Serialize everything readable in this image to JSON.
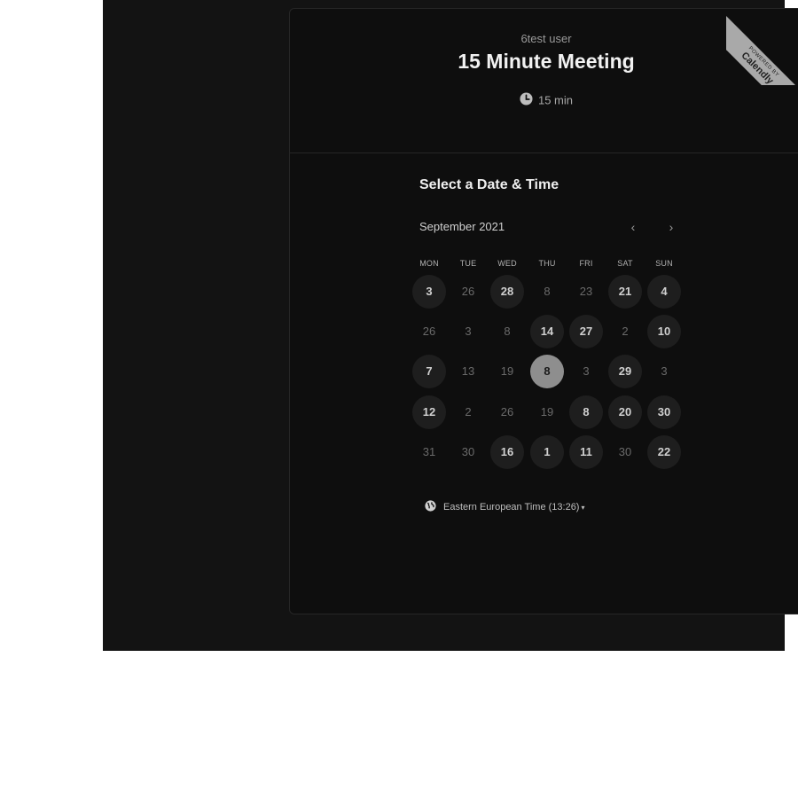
{
  "event": {
    "owner": "6test user",
    "title": "15 Minute Meeting",
    "duration": "15 min"
  },
  "ribbon": {
    "small": "POWERED BY",
    "brand": "Calendly"
  },
  "calendar": {
    "section_title": "Select a Date & Time",
    "month_label": "September 2021",
    "prev_icon": "‹",
    "next_icon": "›",
    "weekdays": [
      "MON",
      "TUE",
      "WED",
      "THU",
      "FRI",
      "SAT",
      "SUN"
    ],
    "rows": [
      [
        {
          "label": "3",
          "state": "available"
        },
        {
          "label": "26",
          "state": "unavailable"
        },
        {
          "label": "28",
          "state": "available"
        },
        {
          "label": "8",
          "state": "unavailable"
        },
        {
          "label": "23",
          "state": "unavailable"
        },
        {
          "label": "21",
          "state": "available"
        },
        {
          "label": "4",
          "state": "available"
        }
      ],
      [
        {
          "label": "26",
          "state": "unavailable"
        },
        {
          "label": "3",
          "state": "unavailable"
        },
        {
          "label": "8",
          "state": "unavailable"
        },
        {
          "label": "14",
          "state": "available"
        },
        {
          "label": "27",
          "state": "available"
        },
        {
          "label": "2",
          "state": "unavailable"
        },
        {
          "label": "10",
          "state": "available"
        }
      ],
      [
        {
          "label": "7",
          "state": "available"
        },
        {
          "label": "13",
          "state": "unavailable"
        },
        {
          "label": "19",
          "state": "unavailable"
        },
        {
          "label": "8",
          "state": "selected"
        },
        {
          "label": "3",
          "state": "unavailable"
        },
        {
          "label": "29",
          "state": "available"
        },
        {
          "label": "3",
          "state": "unavailable"
        }
      ],
      [
        {
          "label": "12",
          "state": "available"
        },
        {
          "label": "2",
          "state": "unavailable"
        },
        {
          "label": "26",
          "state": "unavailable"
        },
        {
          "label": "19",
          "state": "unavailable"
        },
        {
          "label": "8",
          "state": "available"
        },
        {
          "label": "20",
          "state": "available"
        },
        {
          "label": "30",
          "state": "available"
        }
      ],
      [
        {
          "label": "31",
          "state": "unavailable"
        },
        {
          "label": "30",
          "state": "unavailable"
        },
        {
          "label": "16",
          "state": "available"
        },
        {
          "label": "1",
          "state": "available"
        },
        {
          "label": "11",
          "state": "available"
        },
        {
          "label": "30",
          "state": "unavailable"
        },
        {
          "label": "22",
          "state": "available"
        }
      ]
    ]
  },
  "timezone": {
    "label": "Eastern European Time (13:26)",
    "caret": "▾"
  },
  "colors": {
    "background": "#131313",
    "card": "#0e0e0e",
    "available_day": "#1e1e1e",
    "selected_day": "#8e8e8e"
  }
}
